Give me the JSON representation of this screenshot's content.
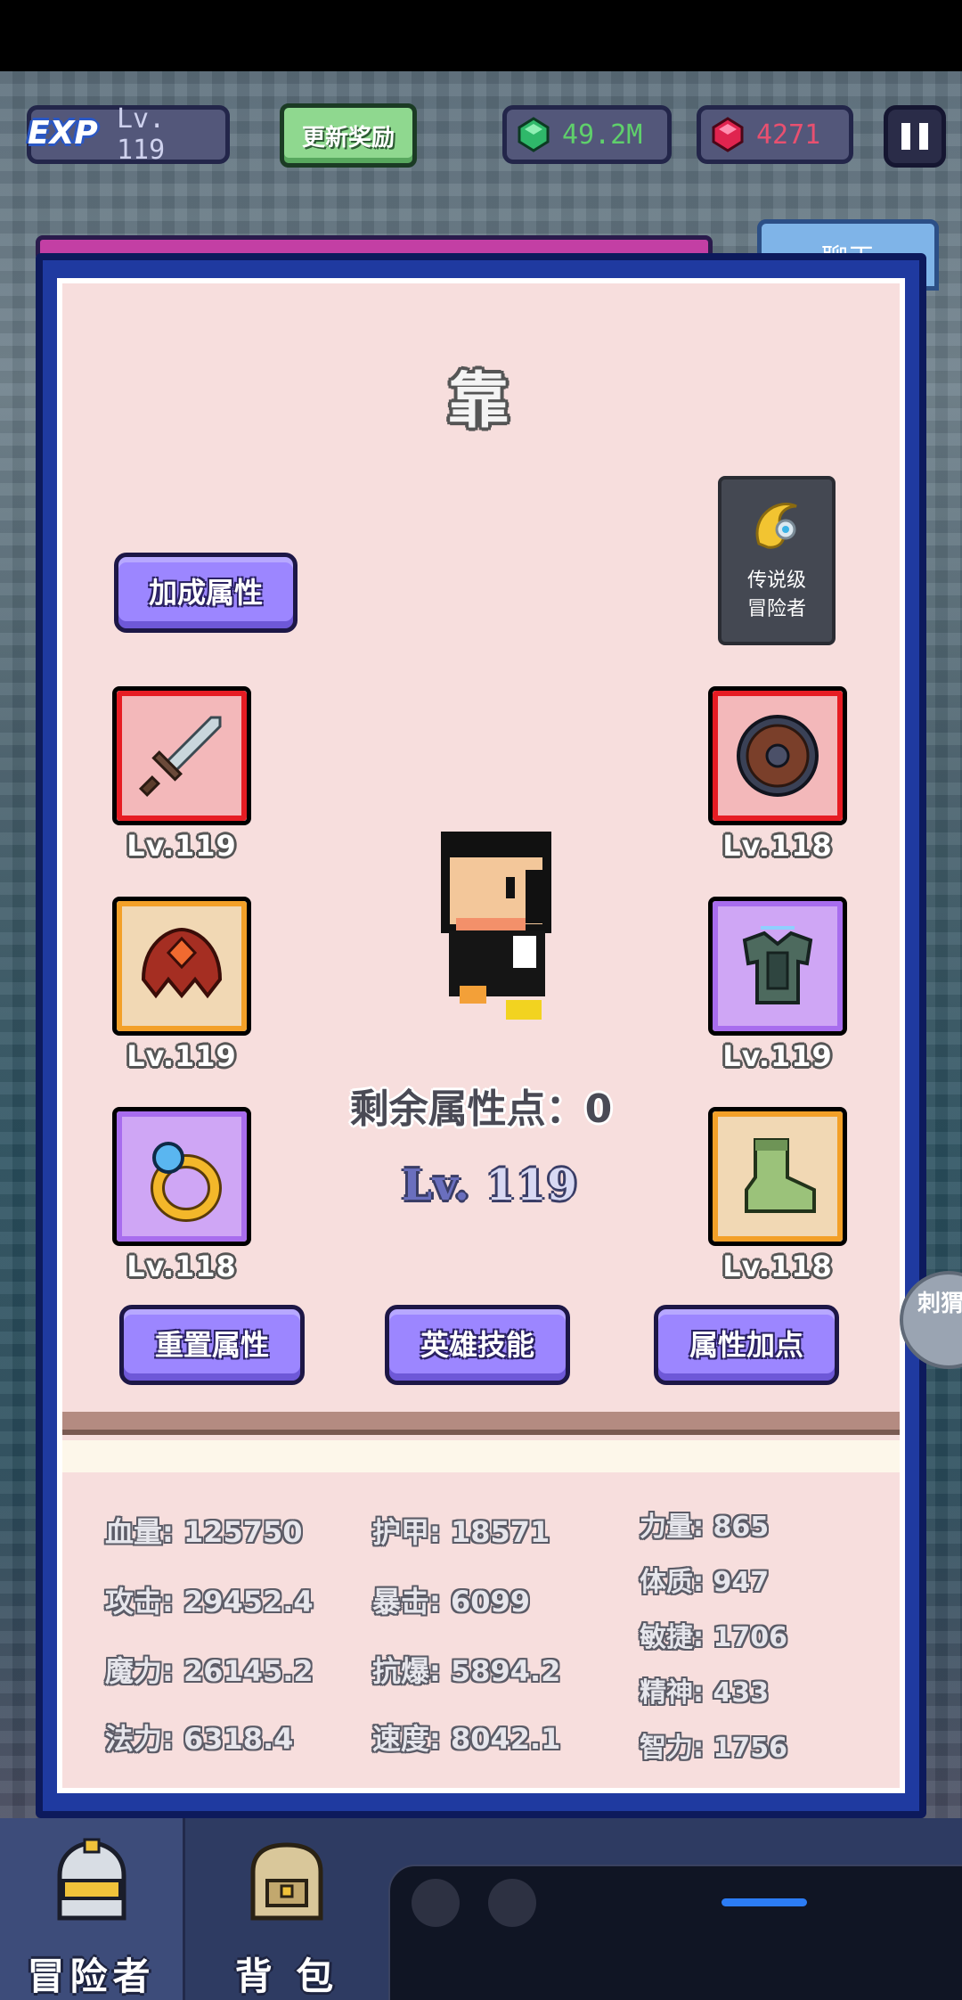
{
  "hud": {
    "exp_tag": "EXP",
    "player_level": "Lv. 119",
    "update_reward_label": "更新奖励",
    "emerald_amount": "49.2M",
    "ruby_amount": "4271",
    "chat_tab_label": "聊天"
  },
  "hero": {
    "name": "靠",
    "badge_line1": "传说级",
    "badge_line2": "冒险者",
    "bonus_button": "加成属性",
    "remaining_points": "剩余属性点：0",
    "level_prefix": "Lv. ",
    "level_value": "119"
  },
  "equipment": [
    {
      "slot": "weapon",
      "icon": "sword-icon",
      "rarity": "red",
      "level": "Lv.119"
    },
    {
      "slot": "shield",
      "icon": "shield-icon",
      "rarity": "red",
      "level": "Lv.118"
    },
    {
      "slot": "helmet",
      "icon": "helmet-icon",
      "rarity": "orange",
      "level": "Lv.119"
    },
    {
      "slot": "armor",
      "icon": "armor-icon",
      "rarity": "purple",
      "level": "Lv.119"
    },
    {
      "slot": "ring",
      "icon": "ring-icon",
      "rarity": "purple",
      "level": "Lv.118"
    },
    {
      "slot": "boots",
      "icon": "boots-icon",
      "rarity": "orange",
      "level": "Lv.118"
    }
  ],
  "actions": {
    "reset": "重置属性",
    "skills": "英雄技能",
    "add_points": "属性加点"
  },
  "stats": {
    "hp": "血量: 125750",
    "attack": "攻击: 29452.4",
    "magic": "魔力: 26145.2",
    "mana": "法力: 6318.4",
    "armor": "护甲: 18571",
    "crit": "暴击: 6099",
    "crit_resist": "抗爆: 5894.2",
    "speed": "速度: 8042.1",
    "strength": "力量: 865",
    "constitution": "体质: 947",
    "agility": "敏捷: 1706",
    "spirit": "精神: 433",
    "intellect": "智力: 1756"
  },
  "side_float_label": "刺猬",
  "nav": {
    "adventurer": "冒险者",
    "bag": "背 包"
  },
  "colors": {
    "panel_frame": "#1f3aa0",
    "panel_bg": "#f7dedd",
    "button_purple": "#9c86ff",
    "rarity_red": "#e61c23",
    "rarity_orange": "#f3a028",
    "rarity_purple": "#a86dee"
  }
}
